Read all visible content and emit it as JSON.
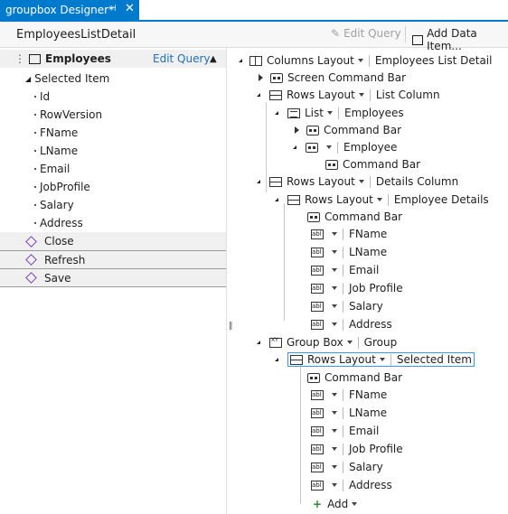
{
  "tab": {
    "title": "groupbox Designer*",
    "pin": "⊣",
    "close": "✕"
  },
  "header": {
    "screen_name": "EmployeesListDetail",
    "edit_query": "Edit Query",
    "add_data_item": "Add Data Item..."
  },
  "left": {
    "collection": "Employees",
    "edit_query": "Edit Query",
    "selected_item": "Selected Item",
    "fields": [
      "Id",
      "RowVersion",
      "FName",
      "LName",
      "Email",
      "JobProfile",
      "Salary",
      "Address"
    ],
    "methods": [
      "Close",
      "Refresh",
      "Save"
    ]
  },
  "tree": {
    "columns_layout": "Columns Layout",
    "columns_layout_name": "Employees List Detail",
    "screen_command_bar": "Screen Command Bar",
    "rows_layout": "Rows Layout",
    "list_column": "List Column",
    "list": "List",
    "employees": "Employees",
    "command_bar": "Command Bar",
    "employee": "Employee",
    "details_column": "Details Column",
    "employee_details": "Employee Details",
    "fields": [
      "FName",
      "LName",
      "Email",
      "Job Profile",
      "Salary",
      "Address"
    ],
    "group_box": "Group Box",
    "group": "Group",
    "selected_item": "Selected Item",
    "add": "Add"
  }
}
